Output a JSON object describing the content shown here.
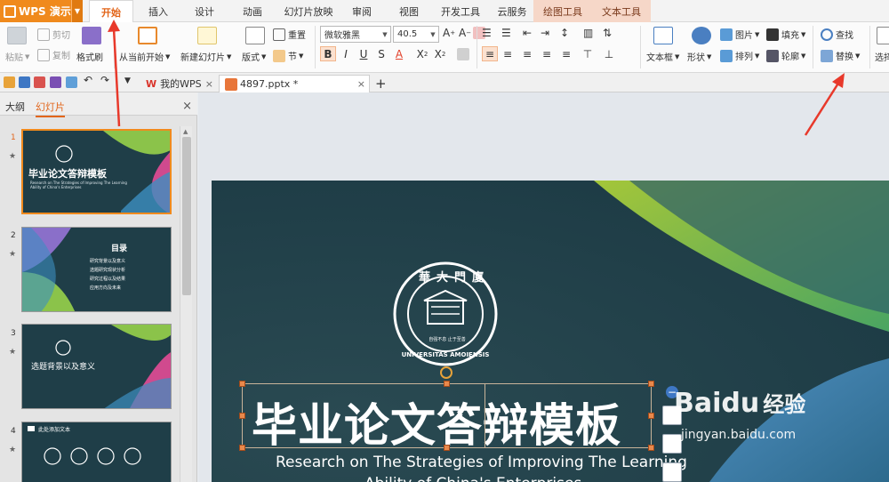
{
  "titlebar": {
    "app_label": "WPS 演示",
    "tabs": [
      {
        "label": "开始"
      },
      {
        "label": "插入"
      },
      {
        "label": "设计"
      },
      {
        "label": "动画"
      },
      {
        "label": "幻灯片放映"
      },
      {
        "label": "审阅"
      },
      {
        "label": "视图"
      },
      {
        "label": "开发工具"
      },
      {
        "label": "云服务"
      },
      {
        "label": "绘图工具"
      },
      {
        "label": "文本工具"
      }
    ]
  },
  "ribbon": {
    "paste": "粘贴",
    "cut": "剪切",
    "copy": "复制",
    "format_painter": "格式刷",
    "from_current": "从当前开始",
    "new_slide": "新建幻灯片",
    "layout": "版式",
    "reset": "重置",
    "section": "节",
    "font_name": "微软雅黑",
    "font_size": "40.5",
    "text_box": "文本框",
    "shape": "形状",
    "picture": "图片",
    "fill": "填充",
    "arrange": "排列",
    "outline": "轮廓",
    "find": "查找",
    "replace": "替换",
    "select": "选择"
  },
  "docbar": {
    "tabs": [
      {
        "label": "我的WPS"
      },
      {
        "label": "4897.pptx *"
      }
    ],
    "add_label": "+"
  },
  "left_panel": {
    "tab_outline": "大纲",
    "tab_slides": "幻灯片",
    "slides": [
      {
        "num": "1",
        "title": "毕业论文答辩模板",
        "subtitle": "Research on The Strategies of Improving The Learning Ability of China's Enterprises"
      },
      {
        "num": "2",
        "title": "目录",
        "items": [
          "研究背景以及意义",
          "选题研究现状分析",
          "研究过程以及结果",
          "应用方向及未来"
        ]
      },
      {
        "num": "3",
        "title": "选题背景以及意义"
      },
      {
        "num": "4",
        "title": "此处添加文本"
      }
    ]
  },
  "slide": {
    "title": "毕业论文答辩模板",
    "subtitle_line1": "Research on The Strategies of Improving The Learning",
    "subtitle_line2": "Ability of China's Enterprises",
    "emblem_top": "華大門廈",
    "emblem_ring": "UNIVERSITAS AMOIENSIS",
    "emblem_center": "自强不息 止于至善"
  },
  "watermark": {
    "brand": "Baidu",
    "jingyan": "经验",
    "url": "jingyan.baidu.com"
  },
  "colors": {
    "accent": "#e2651a",
    "wps_orange": "#f08a1d",
    "slide_bg": "#1f3e48",
    "green_shape": "#8bc34a",
    "annotation_red": "#e8392b"
  }
}
